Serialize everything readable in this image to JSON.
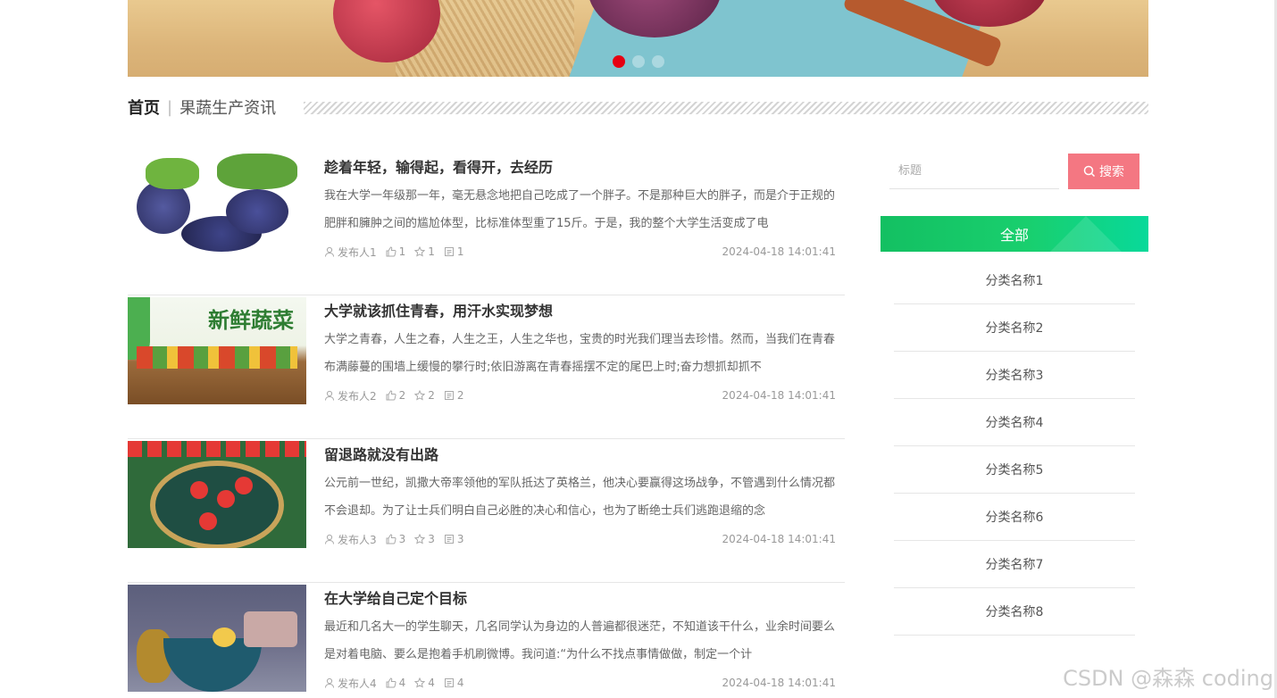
{
  "banner": {
    "dots": 3,
    "active_dot": 0
  },
  "breadcrumb": {
    "home": "首页",
    "separator": "|",
    "current": "果蔬生产资讯"
  },
  "articles": [
    {
      "title": "趁着年轻，输得起，看得开，去经历",
      "summary": "我在大学一年级那一年，毫无悬念地把自己吃成了一个胖子。不是那种巨大的胖子，而是介于正规的肥胖和臃肿之间的尴尬体型，比标准体型重了15斤。于是，我的整个大学生活变成了电",
      "author": "发布人1",
      "likes": "1",
      "favorites": "1",
      "comments": "1",
      "time": "2024-04-18 14:01:41"
    },
    {
      "title": "大学就该抓住青春，用汗水实现梦想",
      "summary": "大学之青春，人生之春，人生之王，人生之华也，宝贵的时光我们理当去珍惜。然而，当我们在青春布满藤蔓的围墙上缓慢的攀行时;依旧游离在青春摇摆不定的尾巴上时;奋力想抓却抓不",
      "author": "发布人2",
      "likes": "2",
      "favorites": "2",
      "comments": "2",
      "time": "2024-04-18 14:01:41"
    },
    {
      "title": "留退路就没有出路",
      "summary": "公元前一世纪，凯撒大帝率领他的军队抵达了英格兰，他决心要赢得这场战争，不管遇到什么情况都不会退却。为了让士兵们明白自己必胜的决心和信心，也为了断绝士兵们逃跑退缩的念",
      "author": "发布人3",
      "likes": "3",
      "favorites": "3",
      "comments": "3",
      "time": "2024-04-18 14:01:41"
    },
    {
      "title": "在大学给自己定个目标",
      "summary": "最近和几名大一的学生聊天，几名同学认为身边的人普遍都很迷茫，不知道该干什么，业余时间要么是对着电脑、要么是抱着手机刷微博。我问道:“为什么不找点事情做做，制定一个计",
      "author": "发布人4",
      "likes": "4",
      "favorites": "4",
      "comments": "4",
      "time": "2024-04-18 14:01:41"
    }
  ],
  "thumbnail_text": {
    "t2": "新鲜蔬菜"
  },
  "sidebar": {
    "search_placeholder": "标题",
    "search_button": "搜索",
    "category_header": "全部",
    "categories": [
      "分类名称1",
      "分类名称2",
      "分类名称3",
      "分类名称4",
      "分类名称5",
      "分类名称6",
      "分类名称7",
      "分类名称8"
    ]
  },
  "watermark": "CSDN @森森 coding",
  "colors": {
    "accent_red": "#e60012",
    "search_button": "#f47782",
    "category_header_from": "#13c062",
    "category_header_to": "#08d99a"
  }
}
